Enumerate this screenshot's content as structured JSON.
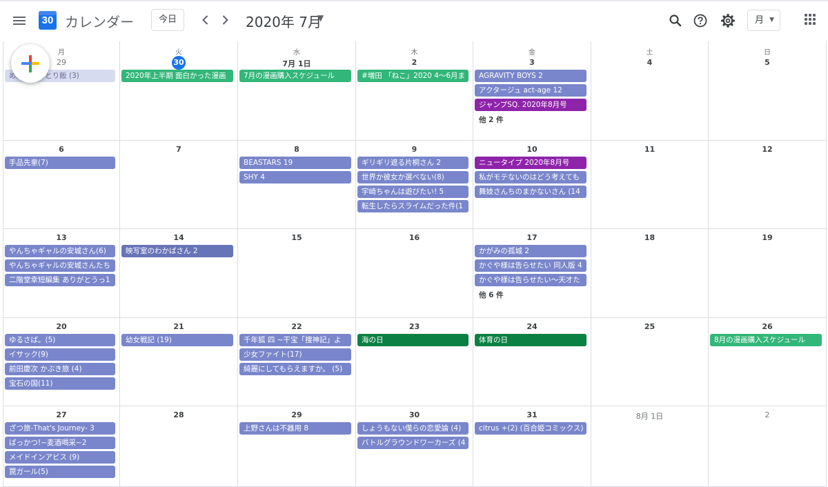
{
  "header": {
    "app_title": "カレンダー",
    "logo_day": "30",
    "today_label": "今日",
    "prev_icon": "chevron-left-icon",
    "next_icon": "chevron-right-icon",
    "month_title": "2020年 7月",
    "view_label": "月",
    "icons": [
      "menu-icon",
      "search-icon",
      "help-icon",
      "gear-icon",
      "apps-grid-icon"
    ]
  },
  "colors": {
    "lavender": "#7986cb",
    "lavender_dark": "#6874b8",
    "lavender_past": "#d7dbf0",
    "green": "#33b679",
    "dark_green": "#0b8043",
    "purple": "#8e24aa",
    "today_blue": "#1a73e8"
  },
  "weekdays": [
    "月",
    "火",
    "水",
    "木",
    "金",
    "土",
    "日"
  ],
  "weeks": [
    {
      "days": [
        {
          "label": "29",
          "other": true,
          "events": [
            {
              "title": "めんつゆひとり飯 (3)",
              "color": "lavender_past",
              "text": "#6a6f9a"
            }
          ]
        },
        {
          "label": "30",
          "today": true,
          "events": [
            {
              "title": "2020年上半期 面白かった漫画",
              "color": "green"
            }
          ]
        },
        {
          "label": "7月 1日",
          "events": [
            {
              "title": "7月の漫画購入スケジュール",
              "color": "green"
            }
          ]
        },
        {
          "label": "2",
          "events": [
            {
              "title": "#増田 「ねこ」2020 4〜6月ま",
              "color": "green"
            }
          ]
        },
        {
          "label": "3",
          "events": [
            {
              "title": "AGRAVITY BOYS 2",
              "color": "lavender"
            },
            {
              "title": "アクタージュ act-age 12",
              "color": "lavender"
            },
            {
              "title": "ジャンプSQ. 2020年8月号",
              "color": "purple"
            }
          ],
          "more": "他 2 件"
        },
        {
          "label": "4",
          "events": []
        },
        {
          "label": "5",
          "events": []
        }
      ]
    },
    {
      "days": [
        {
          "label": "6",
          "events": [
            {
              "title": "手品先輩(7)",
              "color": "lavender"
            }
          ]
        },
        {
          "label": "7",
          "events": []
        },
        {
          "label": "8",
          "events": [
            {
              "title": "BEASTARS 19",
              "color": "lavender"
            },
            {
              "title": "SHY 4",
              "color": "lavender"
            }
          ]
        },
        {
          "label": "9",
          "events": [
            {
              "title": "ギリギリ遮る片桐さん 2",
              "color": "lavender"
            },
            {
              "title": "世界か彼女か選べない(8)",
              "color": "lavender"
            },
            {
              "title": "宇崎ちゃんは遊びたい! 5",
              "color": "lavender"
            },
            {
              "title": "転生したらスライムだった件(1",
              "color": "lavender"
            }
          ]
        },
        {
          "label": "10",
          "events": [
            {
              "title": "ニュータイプ 2020年8月号",
              "color": "purple"
            },
            {
              "title": "私がモテないのはどう考えても",
              "color": "lavender"
            },
            {
              "title": "舞妓さんちのまかないさん (14",
              "color": "lavender"
            }
          ]
        },
        {
          "label": "11",
          "events": []
        },
        {
          "label": "12",
          "events": []
        }
      ]
    },
    {
      "days": [
        {
          "label": "13",
          "events": [
            {
              "title": "やんちゃギャルの安城さん(6)",
              "color": "lavender"
            },
            {
              "title": "やんちゃギャルの安城さんたち",
              "color": "lavender"
            },
            {
              "title": "二階堂幸短編集 ありがとうっ1",
              "color": "lavender"
            }
          ]
        },
        {
          "label": "14",
          "events": [
            {
              "title": "映写室のわかばさん 2",
              "color": "lavender_dark"
            }
          ]
        },
        {
          "label": "15",
          "events": []
        },
        {
          "label": "16",
          "events": []
        },
        {
          "label": "17",
          "events": [
            {
              "title": "かがみの孤城 2",
              "color": "lavender"
            },
            {
              "title": "かぐや様は告らせたい 同人版 4",
              "color": "lavender"
            },
            {
              "title": "かぐや様は告らせたい〜天才た",
              "color": "lavender"
            }
          ],
          "more": "他 6 件"
        },
        {
          "label": "18",
          "events": []
        },
        {
          "label": "19",
          "events": []
        }
      ]
    },
    {
      "days": [
        {
          "label": "20",
          "events": [
            {
              "title": "ゆるさば。(5)",
              "color": "lavender"
            },
            {
              "title": "イサック(9)",
              "color": "lavender"
            },
            {
              "title": "前田慶次 かぶき旅 (4)",
              "color": "lavender"
            },
            {
              "title": "宝石の国(11)",
              "color": "lavender"
            }
          ]
        },
        {
          "label": "21",
          "events": [
            {
              "title": "幼女戦記 (19)",
              "color": "lavender"
            }
          ]
        },
        {
          "label": "22",
          "events": [
            {
              "title": "千年狐 四 ~干宝「捜神記」よ",
              "color": "lavender"
            },
            {
              "title": "少女ファイト(17)",
              "color": "lavender"
            },
            {
              "title": "綺麗にしてもらえますか。 (5)",
              "color": "lavender"
            }
          ]
        },
        {
          "label": "23",
          "events": [
            {
              "title": "海の日",
              "color": "dark_green"
            }
          ]
        },
        {
          "label": "24",
          "events": [
            {
              "title": "体育の日",
              "color": "dark_green"
            }
          ]
        },
        {
          "label": "25",
          "events": []
        },
        {
          "label": "26",
          "events": [
            {
              "title": "8月の漫画購入スケジュール",
              "color": "green"
            }
          ]
        }
      ]
    },
    {
      "days": [
        {
          "label": "27",
          "events": [
            {
              "title": "ざつ旅-That's Journey- 3",
              "color": "lavender"
            },
            {
              "title": "ばっかつ!~麦酒喝采~2",
              "color": "lavender"
            },
            {
              "title": "メイドインアビス (9)",
              "color": "lavender"
            },
            {
              "title": "罠ガール(5)",
              "color": "lavender"
            }
          ]
        },
        {
          "label": "28",
          "events": []
        },
        {
          "label": "29",
          "events": [
            {
              "title": "上野さんは不器用 8",
              "color": "lavender"
            }
          ]
        },
        {
          "label": "30",
          "events": [
            {
              "title": "しょうもない僕らの恋愛論 (4)",
              "color": "lavender"
            },
            {
              "title": "バトルグラウンドワーカーズ (4",
              "color": "lavender"
            }
          ]
        },
        {
          "label": "31",
          "events": [
            {
              "title": "citrus +(2) (百合姫コミックス)",
              "color": "lavender"
            }
          ]
        },
        {
          "label": "8月 1日",
          "other": true,
          "events": []
        },
        {
          "label": "2",
          "other": true,
          "events": []
        }
      ]
    }
  ]
}
